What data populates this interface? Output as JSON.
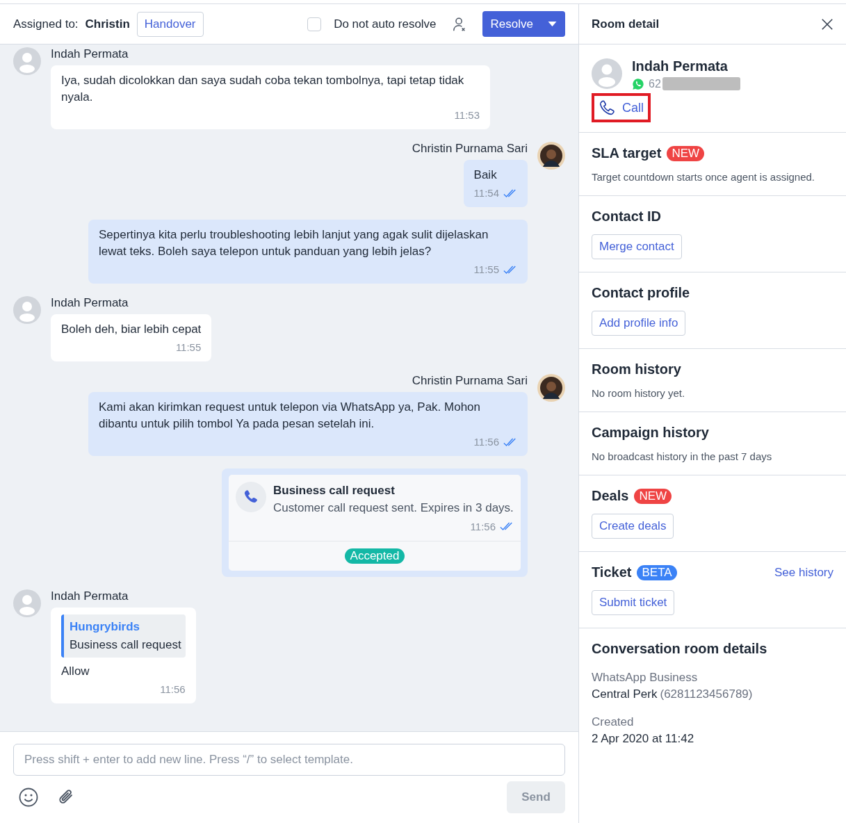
{
  "header": {
    "assigned_label": "Assigned to:",
    "assignee": "Christin",
    "handover": "Handover",
    "auto_resolve": {
      "label": "Do not auto resolve",
      "checked": false
    },
    "resolve": "Resolve"
  },
  "messages": [
    {
      "kind": "incoming",
      "sender": "Indah Permata",
      "text": "Iya, sudah dicolokkan dan saya sudah coba tekan tombolnya, tapi tetap tidak nyala.",
      "time": "11:53"
    },
    {
      "kind": "outgoing",
      "sender": "Christin Purnama Sari",
      "text": "Baik",
      "time": "11:54",
      "read": true
    },
    {
      "kind": "outgoing",
      "text": "Sepertinya kita perlu troubleshooting lebih lanjut yang agak sulit dijelaskan lewat teks. Boleh saya telepon untuk panduan yang lebih jelas?",
      "time": "11:55",
      "read": true
    },
    {
      "kind": "incoming",
      "sender": "Indah Permata",
      "text": "Boleh deh, biar lebih cepat",
      "time": "11:55"
    },
    {
      "kind": "outgoing",
      "sender": "Christin Purnama Sari",
      "text": "Kami akan kirimkan request untuk telepon via WhatsApp ya, Pak. Mohon dibantu untuk pilih tombol Ya pada pesan setelah ini.",
      "time": "11:56",
      "read": true
    },
    {
      "kind": "call_request",
      "title": "Business call request",
      "text": "Customer call request sent. Expires in 3 days.",
      "time": "11:56",
      "read": true,
      "status": "Accepted"
    },
    {
      "kind": "reply",
      "sender": "Indah Permata",
      "quote_author": "Hungrybirds",
      "quote_text": "Business call request",
      "text": "Allow",
      "time": "11:56"
    }
  ],
  "composer": {
    "placeholder": "Press shift + enter to add new line. Press “/” to select template.",
    "send": "Send"
  },
  "panel": {
    "title": "Room detail",
    "contact": {
      "name": "Indah Permata",
      "phone": "62",
      "call": {
        "label": "Call",
        "highlighted": true
      }
    },
    "sections": [
      {
        "title": "SLA target",
        "badge": {
          "text": "NEW",
          "color": "#ef4444"
        },
        "note": "Target countdown starts once agent is assigned."
      },
      {
        "title": "Contact ID",
        "button": "Merge contact"
      },
      {
        "title": "Contact profile",
        "button": "Add profile info"
      },
      {
        "title": "Room history",
        "note": "No room history yet."
      },
      {
        "title": "Campaign history",
        "note": "No broadcast history in the past 7 days"
      },
      {
        "title": "Deals",
        "badge": {
          "text": "NEW",
          "color": "#ef4444"
        },
        "button": "Create deals"
      },
      {
        "title": "Ticket",
        "badge": {
          "text": "BETA",
          "color": "#3b82f6"
        },
        "link": "See history",
        "button": "Submit ticket"
      }
    ],
    "details": {
      "title": "Conversation room details",
      "items": [
        {
          "label": "WhatsApp Business",
          "value": "Central Perk",
          "extra": "(6281123456789)"
        },
        {
          "label": "Created",
          "value": "2 Apr 2020 at 11:42"
        }
      ]
    }
  }
}
